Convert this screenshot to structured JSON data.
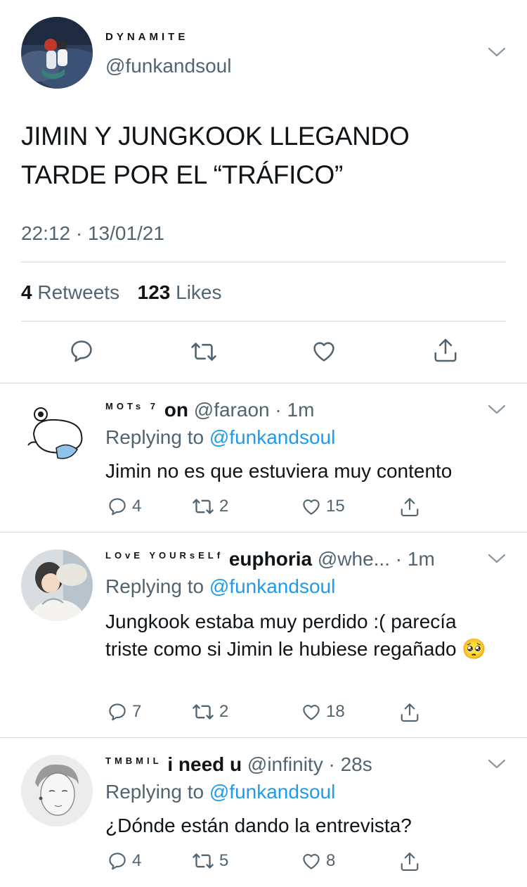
{
  "main_tweet": {
    "display_name": "DYNAMITE",
    "handle": "@funkandsoul",
    "text_line1": "JIMIN Y JUNGKOOK LLEGANDO",
    "text_line2": "TARDE POR EL “TRÁFICO”",
    "timestamp": "22:12 · 13/01/21",
    "retweets_count": "4",
    "retweets_label": "Retweets",
    "likes_count": "123",
    "likes_label": "Likes",
    "actions": [
      "reply-icon",
      "retweet-icon",
      "like-icon",
      "share-icon"
    ]
  },
  "replies": [
    {
      "name_deco": "MOTs 7",
      "name_bold": "on",
      "handle": "@faraon",
      "time": "· 1m",
      "replying_prefix": "Replying to",
      "replying_handle": "@funkandsoul",
      "text": "Jimin no es que estuviera muy contento",
      "reply_count": "4",
      "retweet_count": "2",
      "like_count": "15"
    },
    {
      "name_deco": "LOvE YOURsELf",
      "name_bold": "euphoria",
      "handle": "@whe...",
      "time": "· 1m",
      "replying_prefix": "Replying to",
      "replying_handle": "@funkandsoul",
      "text": "Jungkook estaba muy perdido :( parecía triste como si Jimin le hubiese regañado 🥺",
      "reply_count": "7",
      "retweet_count": "2",
      "like_count": "18"
    },
    {
      "name_deco": "TMBMIL",
      "name_bold": "i need u",
      "handle": "@infinity",
      "time": "· 28s",
      "replying_prefix": "Replying to",
      "replying_handle": "@funkandsoul",
      "text": "¿Dónde están dando la entrevista?",
      "reply_count": "4",
      "retweet_count": "5",
      "like_count": "8"
    }
  ],
  "colors": {
    "text_primary": "#0f1419",
    "text_secondary": "#536471",
    "accent": "#1d9bf0",
    "divider": "#cfd9de"
  }
}
